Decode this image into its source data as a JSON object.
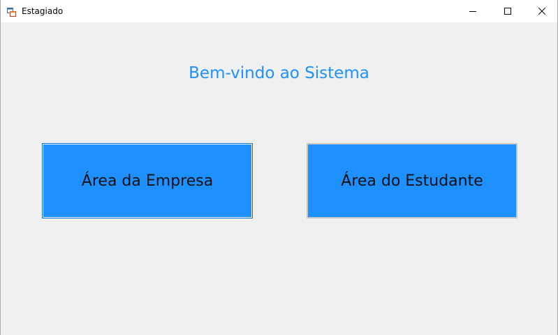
{
  "window": {
    "title": "Estagiado"
  },
  "main": {
    "welcome_text": "Bem-vindo ao Sistema",
    "buttons": {
      "empresa_label": "Área da Empresa",
      "estudante_label": "Área do Estudante"
    }
  },
  "colors": {
    "accent": "#1e90ff",
    "background": "#f0f0f0"
  },
  "icons": {
    "app": "app-icon",
    "minimize": "minimize-icon",
    "maximize": "maximize-icon",
    "close": "close-icon"
  }
}
